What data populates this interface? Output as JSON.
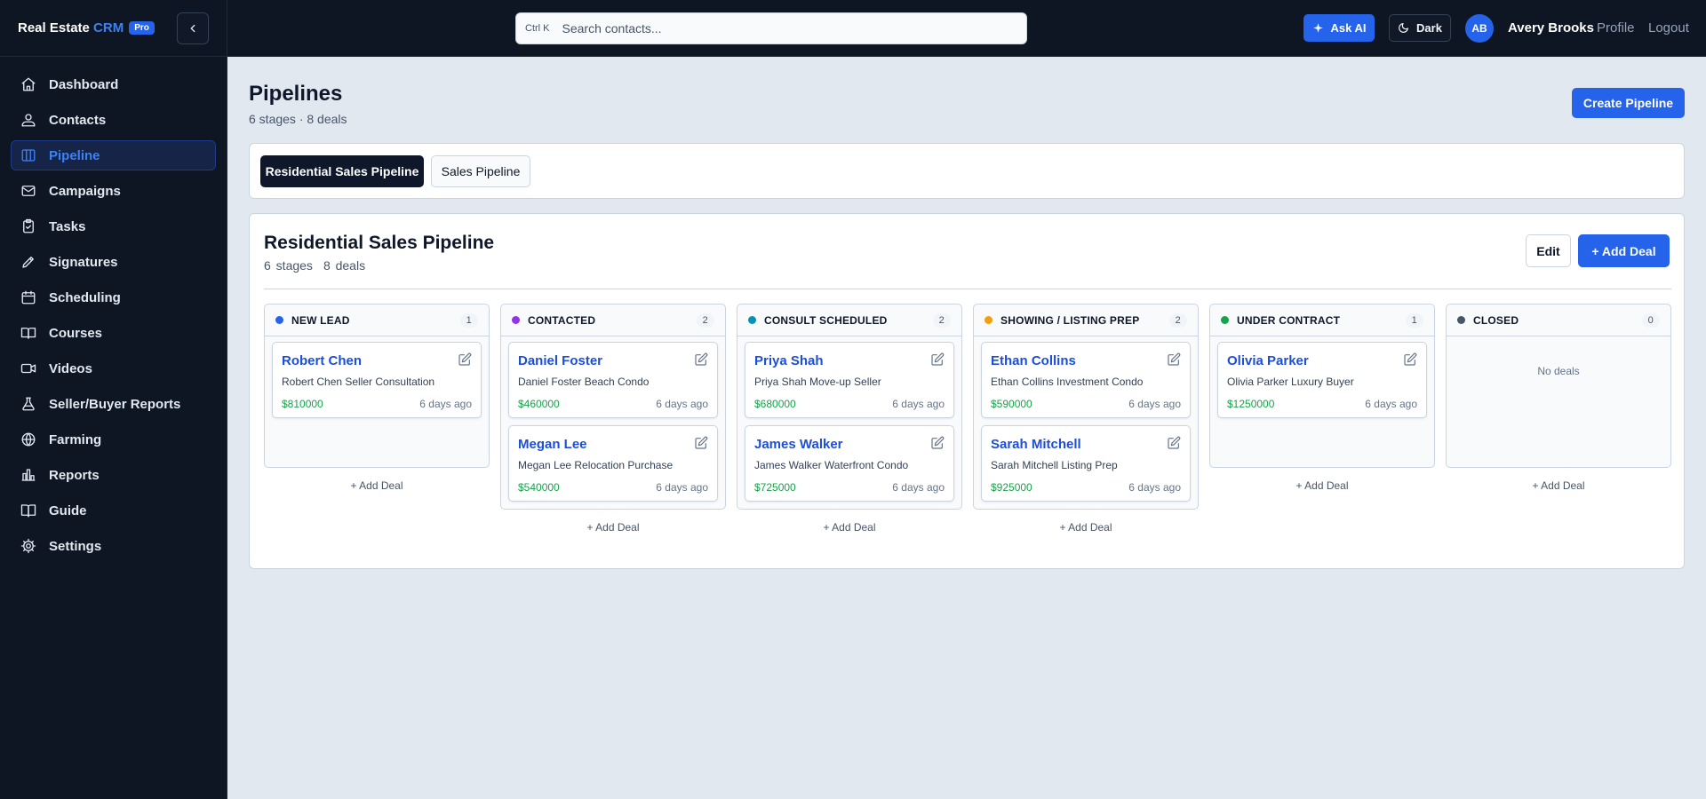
{
  "app": {
    "brand_main": "Real Estate",
    "brand_accent": "CRM",
    "badge": "Pro"
  },
  "sidebar": {
    "items": [
      {
        "label": "Dashboard",
        "icon": "home-icon"
      },
      {
        "label": "Contacts",
        "icon": "users-icon"
      },
      {
        "label": "Pipeline",
        "icon": "columns-icon",
        "active": true
      },
      {
        "label": "Campaigns",
        "icon": "mail-icon"
      },
      {
        "label": "Tasks",
        "icon": "clipboard-icon"
      },
      {
        "label": "Signatures",
        "icon": "pen-icon"
      },
      {
        "label": "Scheduling",
        "icon": "calendar-icon"
      },
      {
        "label": "Courses",
        "icon": "book-icon"
      },
      {
        "label": "Videos",
        "icon": "video-icon"
      },
      {
        "label": "Seller/Buyer Reports",
        "icon": "flask-icon"
      },
      {
        "label": "Farming",
        "icon": "globe-icon"
      },
      {
        "label": "Reports",
        "icon": "bar-chart-icon"
      },
      {
        "label": "Guide",
        "icon": "book-open-icon"
      },
      {
        "label": "Settings",
        "icon": "gear-icon"
      }
    ]
  },
  "topbar": {
    "shortcut": "Ctrl K",
    "search_placeholder": "Search contacts...",
    "ask_ai": "Ask AI",
    "dark": "Dark",
    "avatar_initials": "AB",
    "user_name": "Avery Brooks",
    "profile": "Profile",
    "logout": "Logout"
  },
  "page": {
    "title": "Pipelines",
    "subtitle": "6 stages · 8 deals",
    "create_button": "Create Pipeline"
  },
  "tabs": [
    {
      "label": "Residential Sales Pipeline",
      "active": true
    },
    {
      "label": "Sales Pipeline",
      "active": false
    }
  ],
  "board": {
    "title": "Residential Sales Pipeline",
    "stages_text": "6 stages",
    "deals_text": "8 deals",
    "edit": "Edit",
    "add_deal": "+ Add Deal",
    "add_deal_link": "+ Add Deal",
    "no_deals": "No deals",
    "columns": [
      {
        "name": "NEW LEAD",
        "count": "1",
        "color": "#2563eb",
        "deals": [
          {
            "name": "Robert Chen",
            "desc": "Robert Chen Seller Consultation",
            "value": "$810000",
            "age": "6 days ago"
          }
        ]
      },
      {
        "name": "CONTACTED",
        "count": "2",
        "color": "#9333ea",
        "deals": [
          {
            "name": "Daniel Foster",
            "desc": "Daniel Foster Beach Condo",
            "value": "$460000",
            "age": "6 days ago"
          },
          {
            "name": "Megan Lee",
            "desc": "Megan Lee Relocation Purchase",
            "value": "$540000",
            "age": "6 days ago"
          }
        ]
      },
      {
        "name": "CONSULT SCHEDULED",
        "count": "2",
        "color": "#0891b2",
        "deals": [
          {
            "name": "Priya Shah",
            "desc": "Priya Shah Move-up Seller",
            "value": "$680000",
            "age": "6 days ago"
          },
          {
            "name": "James Walker",
            "desc": "James Walker Waterfront Condo",
            "value": "$725000",
            "age": "6 days ago"
          }
        ]
      },
      {
        "name": "SHOWING / LISTING PREP",
        "count": "2",
        "color": "#f59e0b",
        "deals": [
          {
            "name": "Ethan Collins",
            "desc": "Ethan Collins Investment Condo",
            "value": "$590000",
            "age": "6 days ago"
          },
          {
            "name": "Sarah Mitchell",
            "desc": "Sarah Mitchell Listing Prep",
            "value": "$925000",
            "age": "6 days ago"
          }
        ]
      },
      {
        "name": "UNDER CONTRACT",
        "count": "1",
        "color": "#16a34a",
        "deals": [
          {
            "name": "Olivia Parker",
            "desc": "Olivia Parker Luxury Buyer",
            "value": "$1250000",
            "age": "6 days ago"
          }
        ]
      },
      {
        "name": "CLOSED",
        "count": "0",
        "color": "#475569",
        "deals": []
      }
    ]
  }
}
